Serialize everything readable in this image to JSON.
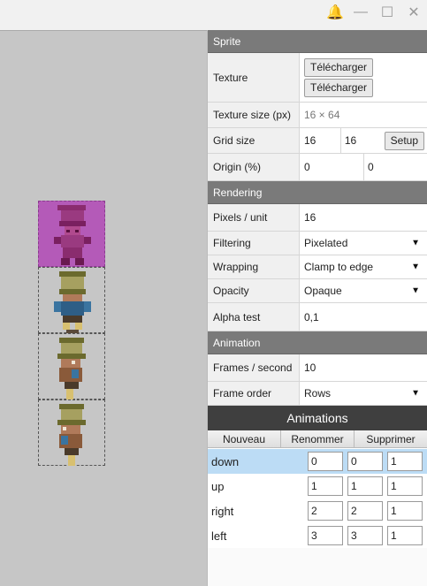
{
  "window": {
    "buttons": [
      {
        "name": "notifications",
        "glyph": "🔔"
      },
      {
        "name": "minimize",
        "glyph": "—"
      },
      {
        "name": "maximize",
        "glyph": "☐"
      },
      {
        "name": "close",
        "glyph": "✕"
      }
    ]
  },
  "sprite": {
    "header": "Sprite",
    "texture_label": "Texture",
    "texture_buttons": [
      "Télécharger",
      "Télécharger"
    ],
    "texture_size_label": "Texture size (px)",
    "texture_size_value": "16 × 64",
    "grid_size_label": "Grid size",
    "grid_w": "16",
    "grid_h": "16",
    "setup_label": "Setup",
    "origin_label": "Origin (%)",
    "origin_x": "0",
    "origin_y": "0"
  },
  "rendering": {
    "header": "Rendering",
    "pixels_label": "Pixels / unit",
    "pixels_value": "16",
    "filtering_label": "Filtering",
    "filtering_value": "Pixelated",
    "wrapping_label": "Wrapping",
    "wrapping_value": "Clamp to edge",
    "opacity_label": "Opacity",
    "opacity_value": "Opaque",
    "alpha_label": "Alpha test",
    "alpha_value": "0,1"
  },
  "animation": {
    "header": "Animation",
    "fps_label": "Frames / second",
    "fps_value": "10",
    "order_label": "Frame order",
    "order_value": "Rows"
  },
  "animations": {
    "header": "Animations",
    "buttons": [
      "Nouveau",
      "Renommer",
      "Supprimer"
    ],
    "items": [
      {
        "name": "down",
        "start": "0",
        "end": "0",
        "speed": "1",
        "selected": true
      },
      {
        "name": "up",
        "start": "1",
        "end": "1",
        "speed": "1",
        "selected": false
      },
      {
        "name": "right",
        "start": "2",
        "end": "2",
        "speed": "1",
        "selected": false
      },
      {
        "name": "left",
        "start": "3",
        "end": "3",
        "speed": "1",
        "selected": false
      }
    ]
  },
  "colors": {
    "viewport_bg": "#c6c6c6",
    "selected_cell": "#b45ab8",
    "section_header": "#7a7a7a",
    "animations_header": "#3f3f3f",
    "selected_row": "#bcdcf5"
  }
}
